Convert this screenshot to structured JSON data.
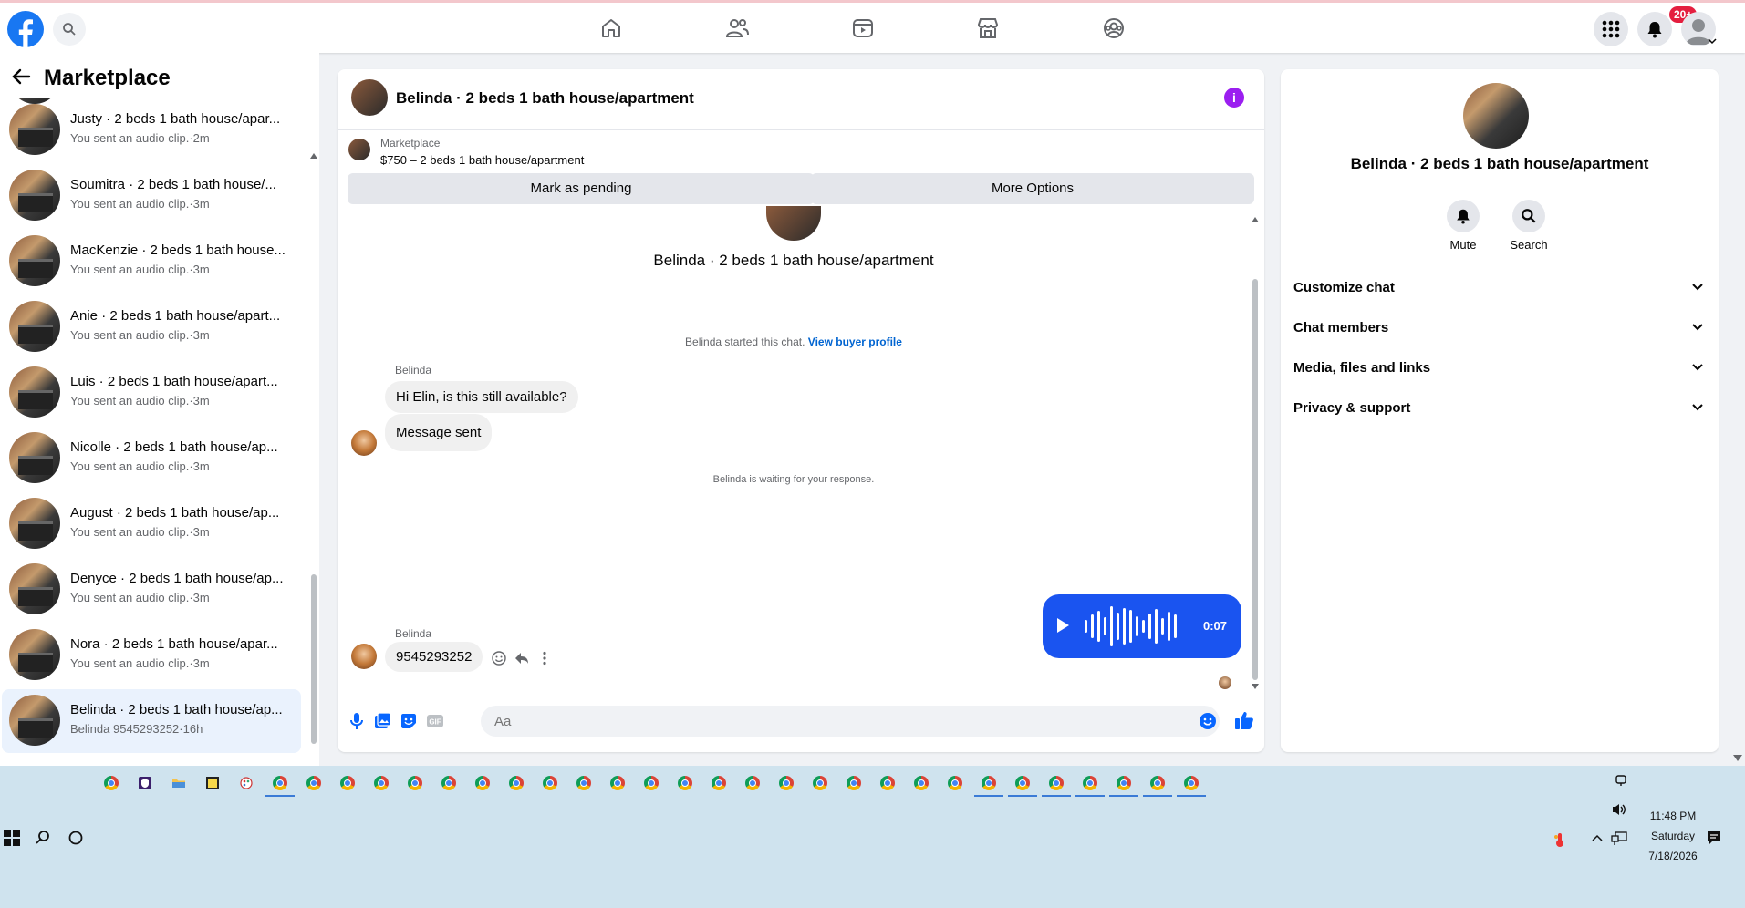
{
  "topbar": {
    "notification_badge": "20+"
  },
  "left_panel": {
    "title": "Marketplace",
    "conversations": [
      {
        "name": "Justy · 2 beds 1 bath house/apar...",
        "sub": "You sent an audio clip.·2m"
      },
      {
        "name": "Soumitra · 2 beds 1 bath house/...",
        "sub": "You sent an audio clip.·3m"
      },
      {
        "name": "MacKenzie · 2 beds 1 bath house...",
        "sub": "You sent an audio clip.·3m"
      },
      {
        "name": "Anie · 2 beds 1 bath house/apart...",
        "sub": "You sent an audio clip.·3m"
      },
      {
        "name": "Luis · 2 beds 1 bath house/apart...",
        "sub": "You sent an audio clip.·3m"
      },
      {
        "name": "Nicolle · 2 beds 1 bath house/ap...",
        "sub": "You sent an audio clip.·3m"
      },
      {
        "name": "August · 2 beds 1 bath house/ap...",
        "sub": "You sent an audio clip.·3m"
      },
      {
        "name": "Denyce · 2 beds 1 bath house/ap...",
        "sub": "You sent an audio clip.·3m"
      },
      {
        "name": "Nora · 2 beds 1 bath house/apar...",
        "sub": "You sent an audio clip.·3m"
      },
      {
        "name": "Belinda · 2 beds 1 bath house/ap...",
        "sub": "Belinda 9545293252·16h"
      }
    ]
  },
  "chat": {
    "title": "Belinda · 2 beds 1 bath house/apartment",
    "marketplace_label": "Marketplace",
    "listing": "$750 – 2 beds 1 bath house/apartment",
    "btn_pending": "Mark as pending",
    "btn_more": "More Options",
    "intro_name": "Belinda · 2 beds 1 bath house/apartment",
    "started_text": "Belinda started this chat.",
    "view_profile": "View buyer profile",
    "sender1": "Belinda",
    "msg1": "Hi Elin, is this still available?",
    "msg2": "Message sent",
    "waiting_text": "Belinda is waiting for your response.",
    "audio_time": "0:07",
    "sender2": "Belinda",
    "msg3": "9545293252",
    "input_placeholder": "Aa"
  },
  "info_panel": {
    "name": "Belinda · 2 beds 1 bath house/apartment",
    "mute_label": "Mute",
    "search_label": "Search",
    "sections": [
      "Customize chat",
      "Chat members",
      "Media, files and links",
      "Privacy & support"
    ]
  },
  "taskbar": {
    "time": "11:48 PM",
    "day": "Saturday",
    "date": "7/18/2026"
  },
  "colors": {
    "brand_blue": "#1877f2",
    "audio_bubble": "#1a54f0",
    "info_purple": "#9b1ef0",
    "badge_red": "#e41e3f"
  }
}
